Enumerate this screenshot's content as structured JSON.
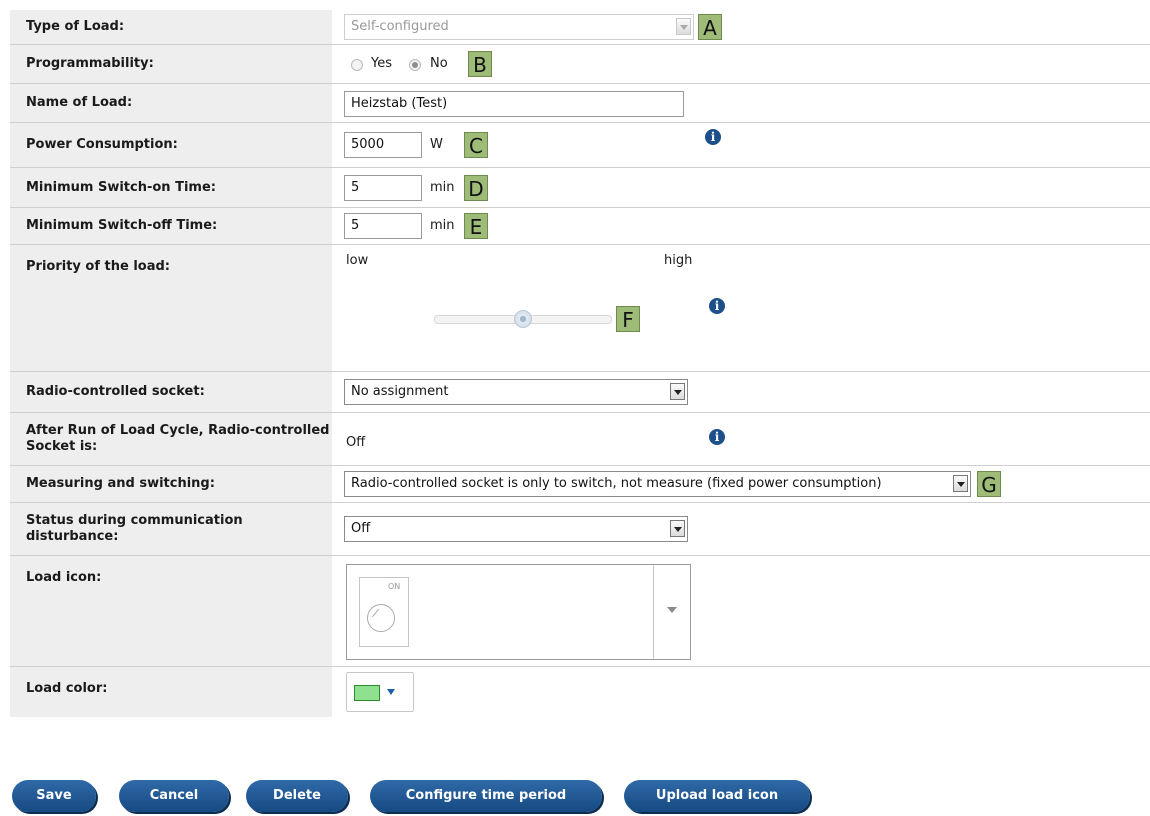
{
  "form": {
    "type_of_load": {
      "label": "Type of Load:",
      "value": "Self-configured",
      "badge": "A"
    },
    "programmability": {
      "label": "Programmability:",
      "option_yes": "Yes",
      "option_no": "No",
      "selected": "No",
      "badge": "B"
    },
    "name_of_load": {
      "label": "Name of Load:",
      "value": "Heizstab (Test)"
    },
    "power_consumption": {
      "label": "Power Consumption:",
      "value": "5000",
      "unit": "W",
      "badge": "C"
    },
    "min_switch_on": {
      "label": "Minimum Switch-on Time:",
      "value": "5",
      "unit": "min",
      "badge": "D"
    },
    "min_switch_off": {
      "label": "Minimum Switch-off Time:",
      "value": "5",
      "unit": "min",
      "badge": "E"
    },
    "priority": {
      "label": "Priority of the load:",
      "low": "low",
      "high": "high",
      "level": 0.5,
      "badge": "F"
    },
    "radio_socket": {
      "label": "Radio-controlled socket:",
      "value": "No assignment"
    },
    "after_run": {
      "label": "After Run of Load Cycle, Radio-controlled Socket is:",
      "value": "Off"
    },
    "measuring": {
      "label": "Measuring and switching:",
      "value": "Radio-controlled socket is only to switch, not measure (fixed power consumption)",
      "badge": "G"
    },
    "status_disturbance": {
      "label": "Status during communication disturbance:",
      "value": "Off"
    },
    "load_icon": {
      "label": "Load icon:",
      "icon_text": "ON",
      "icon": "dial-switch-icon"
    },
    "load_color": {
      "label": "Load color:",
      "color": "#8fe08f"
    }
  },
  "buttons": {
    "save": "Save",
    "cancel": "Cancel",
    "delete": "Delete",
    "configure": "Configure time period",
    "upload": "Upload load icon"
  },
  "colors": {
    "badge": "#9ebc78",
    "button": "#1f5a96",
    "label_bg": "#eeeeee",
    "info": "#1d4f8a"
  }
}
